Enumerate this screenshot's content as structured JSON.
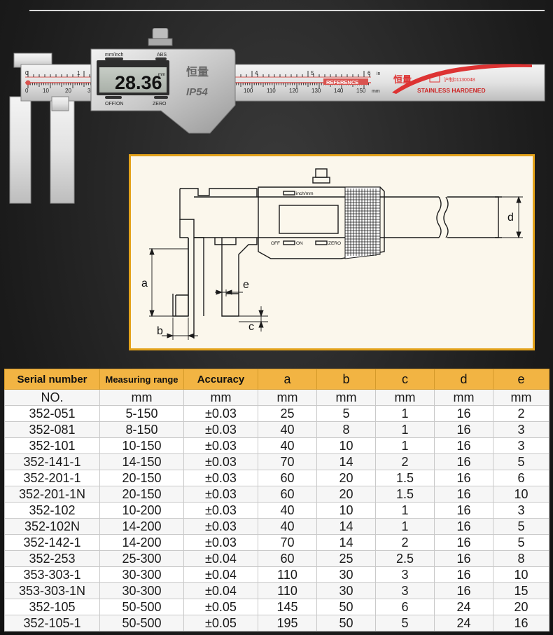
{
  "caliper": {
    "display_reading": "28.36",
    "display_unit": "mm",
    "label_mm_inch": "mm/inch",
    "label_abs": "ABS",
    "label_off_on": "OFF/ON",
    "label_zero": "ZERO",
    "brand_glyph": "恒量",
    "ip_rating": "IP54",
    "reference_label": "REFERENCE",
    "stainless_label": "STAINLESS HARDENED",
    "license": "沪制01130048",
    "inch_unit": "in",
    "mm_unit": "mm",
    "inch_ticks": [
      "0",
      "1",
      "4",
      "5",
      "6"
    ],
    "mm_ticks": [
      "0",
      "10",
      "20",
      "3",
      "100",
      "110",
      "120",
      "130",
      "140",
      "150"
    ]
  },
  "drawing": {
    "inch_mm_label": "inch/mm",
    "off_label": "OFF",
    "on_label": "ON",
    "zero_label": "ZERO",
    "dim_a": "a",
    "dim_b": "b",
    "dim_c": "c",
    "dim_d": "d",
    "dim_e": "e"
  },
  "table": {
    "headers": [
      "Serial number",
      "Measuring range",
      "Accuracy",
      "a",
      "b",
      "c",
      "d",
      "e"
    ],
    "units": [
      "NO.",
      "mm",
      "mm",
      "mm",
      "mm",
      "mm",
      "mm",
      "mm"
    ],
    "rows": [
      [
        "352-051",
        "5-150",
        "±0.03",
        "25",
        "5",
        "1",
        "16",
        "2"
      ],
      [
        "352-081",
        "8-150",
        "±0.03",
        "40",
        "8",
        "1",
        "16",
        "3"
      ],
      [
        "352-101",
        "10-150",
        "±0.03",
        "40",
        "10",
        "1",
        "16",
        "3"
      ],
      [
        "352-141-1",
        "14-150",
        "±0.03",
        "70",
        "14",
        "2",
        "16",
        "5"
      ],
      [
        "352-201-1",
        "20-150",
        "±0.03",
        "60",
        "20",
        "1.5",
        "16",
        "6"
      ],
      [
        "352-201-1N",
        "20-150",
        "±0.03",
        "60",
        "20",
        "1.5",
        "16",
        "10"
      ],
      [
        "352-102",
        "10-200",
        "±0.03",
        "40",
        "10",
        "1",
        "16",
        "3"
      ],
      [
        "352-102N",
        "14-200",
        "±0.03",
        "40",
        "14",
        "1",
        "16",
        "5"
      ],
      [
        "352-142-1",
        "14-200",
        "±0.03",
        "70",
        "14",
        "2",
        "16",
        "5"
      ],
      [
        "352-253",
        "25-300",
        "±0.04",
        "60",
        "25",
        "2.5",
        "16",
        "8"
      ],
      [
        "353-303-1",
        "30-300",
        "±0.04",
        "110",
        "30",
        "3",
        "16",
        "10"
      ],
      [
        "353-303-1N",
        "30-300",
        "±0.04",
        "110",
        "30",
        "3",
        "16",
        "15"
      ],
      [
        "352-105",
        "50-500",
        "±0.05",
        "145",
        "50",
        "6",
        "24",
        "20"
      ],
      [
        "352-105-1",
        "50-500",
        "±0.05",
        "195",
        "50",
        "5",
        "24",
        "16"
      ]
    ]
  }
}
